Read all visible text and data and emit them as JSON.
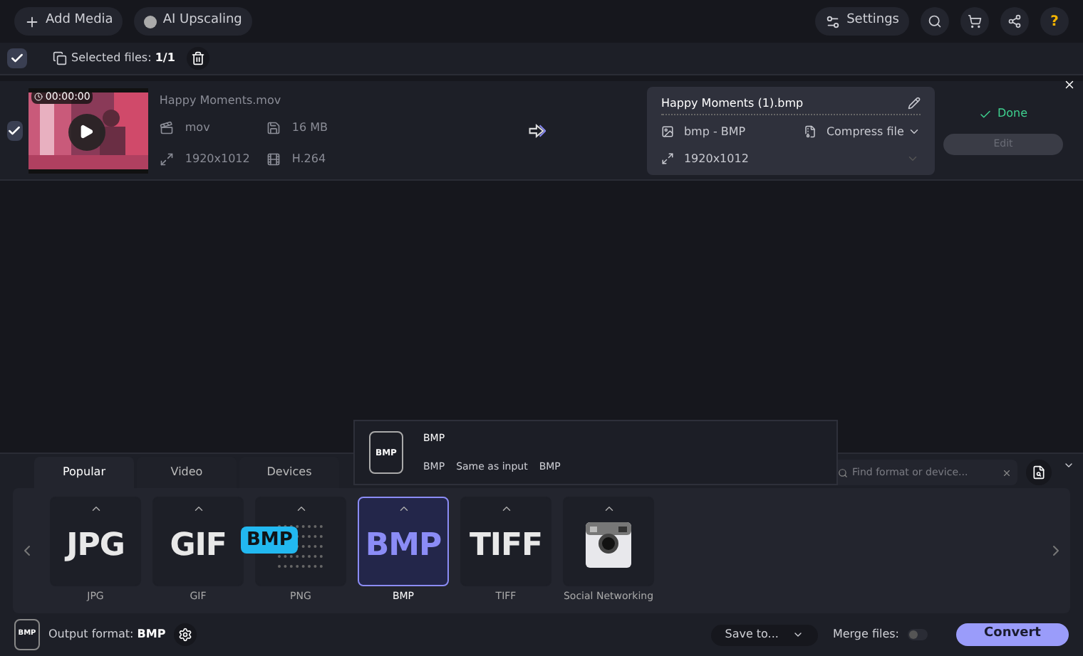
{
  "toolbar": {
    "add_media": "Add Media",
    "ai_upscaling": "AI Upscaling",
    "settings": "Settings",
    "help": "?"
  },
  "selection": {
    "checked": true,
    "label": "Selected files:",
    "count": "1/1"
  },
  "file": {
    "checked": true,
    "duration": "00:00:00",
    "name": "Happy Moments.mov",
    "format": "mov",
    "size": "16 MB",
    "resolution": "1920x1012",
    "codec": "H.264"
  },
  "output": {
    "name": "Happy Moments (1).bmp",
    "format": "bmp - BMP",
    "compress": "Compress file",
    "resolution": "1920x1012",
    "status": "Done",
    "edit": "Edit"
  },
  "tabs": [
    {
      "label": "Popular",
      "selected": true
    },
    {
      "label": "Video",
      "selected": false
    },
    {
      "label": "Devices",
      "selected": false
    }
  ],
  "popup": {
    "icon": "BMP",
    "title": "BMP",
    "details": [
      "BMP",
      "Same as input",
      "BMP"
    ]
  },
  "search": {
    "placeholder": "Find format or device..."
  },
  "formats": [
    {
      "logo": "JPG",
      "label": "JPG",
      "selected": false
    },
    {
      "logo": "GIF",
      "label": "GIF",
      "selected": false
    },
    {
      "label": "PNG",
      "selected": false,
      "tooltip": "BMP"
    },
    {
      "logo": "BMP",
      "label": "BMP",
      "selected": true
    },
    {
      "logo": "TIFF",
      "label": "TIFF",
      "selected": false
    },
    {
      "kind": "camera",
      "label": "Social Networking",
      "selected": false
    }
  ],
  "footer": {
    "icon": "BMP",
    "label": "Output format:",
    "value": "BMP",
    "save_to": "Save to...",
    "merge": "Merge files:",
    "merge_on": false,
    "convert": "Convert"
  }
}
